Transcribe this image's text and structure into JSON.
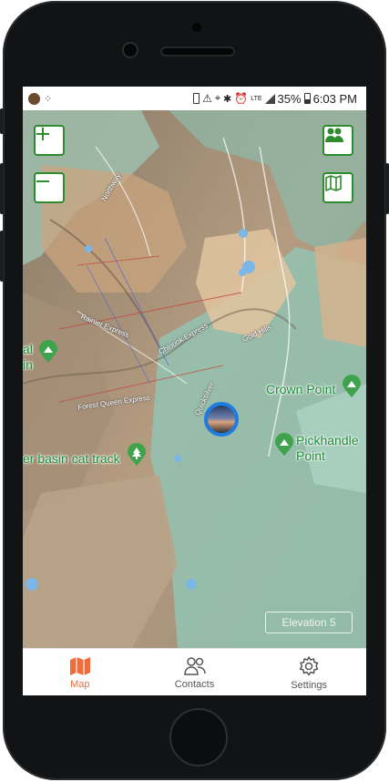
{
  "status_bar": {
    "network": "LTE",
    "battery": "35%",
    "time": "6:03 PM"
  },
  "map": {
    "labels": {
      "crown_point": "Crown Point",
      "pickhandle_point_line1": "Pickhandle",
      "pickhandle_point_line2": "Point",
      "cat_track": "er basin cat track",
      "left_partial_1": "al",
      "left_partial_2": "in"
    },
    "lift_labels": {
      "northway": "Northway",
      "rainier": "Rainier Express",
      "chinook": "Chinook Express",
      "gold_hills": "Gold Hills",
      "forest_queen": "Forest Queen Express",
      "quicksilver": "Quicksilver"
    },
    "elevation_label": "Elevation  5",
    "icons": {
      "zoom_in": "plus-icon",
      "zoom_out": "minus-icon",
      "contacts": "people-icon",
      "layers": "map-icon"
    }
  },
  "tabs": [
    {
      "label": "Map",
      "icon": "map-icon",
      "active": true
    },
    {
      "label": "Contacts",
      "icon": "contacts-icon",
      "active": false
    },
    {
      "label": "Settings",
      "icon": "gear-icon",
      "active": false
    }
  ],
  "colors": {
    "accent": "#f26b3a",
    "map_button": "#2e8b2e",
    "location_ring": "#1e7be0",
    "label_green": "#1f8a3a"
  }
}
